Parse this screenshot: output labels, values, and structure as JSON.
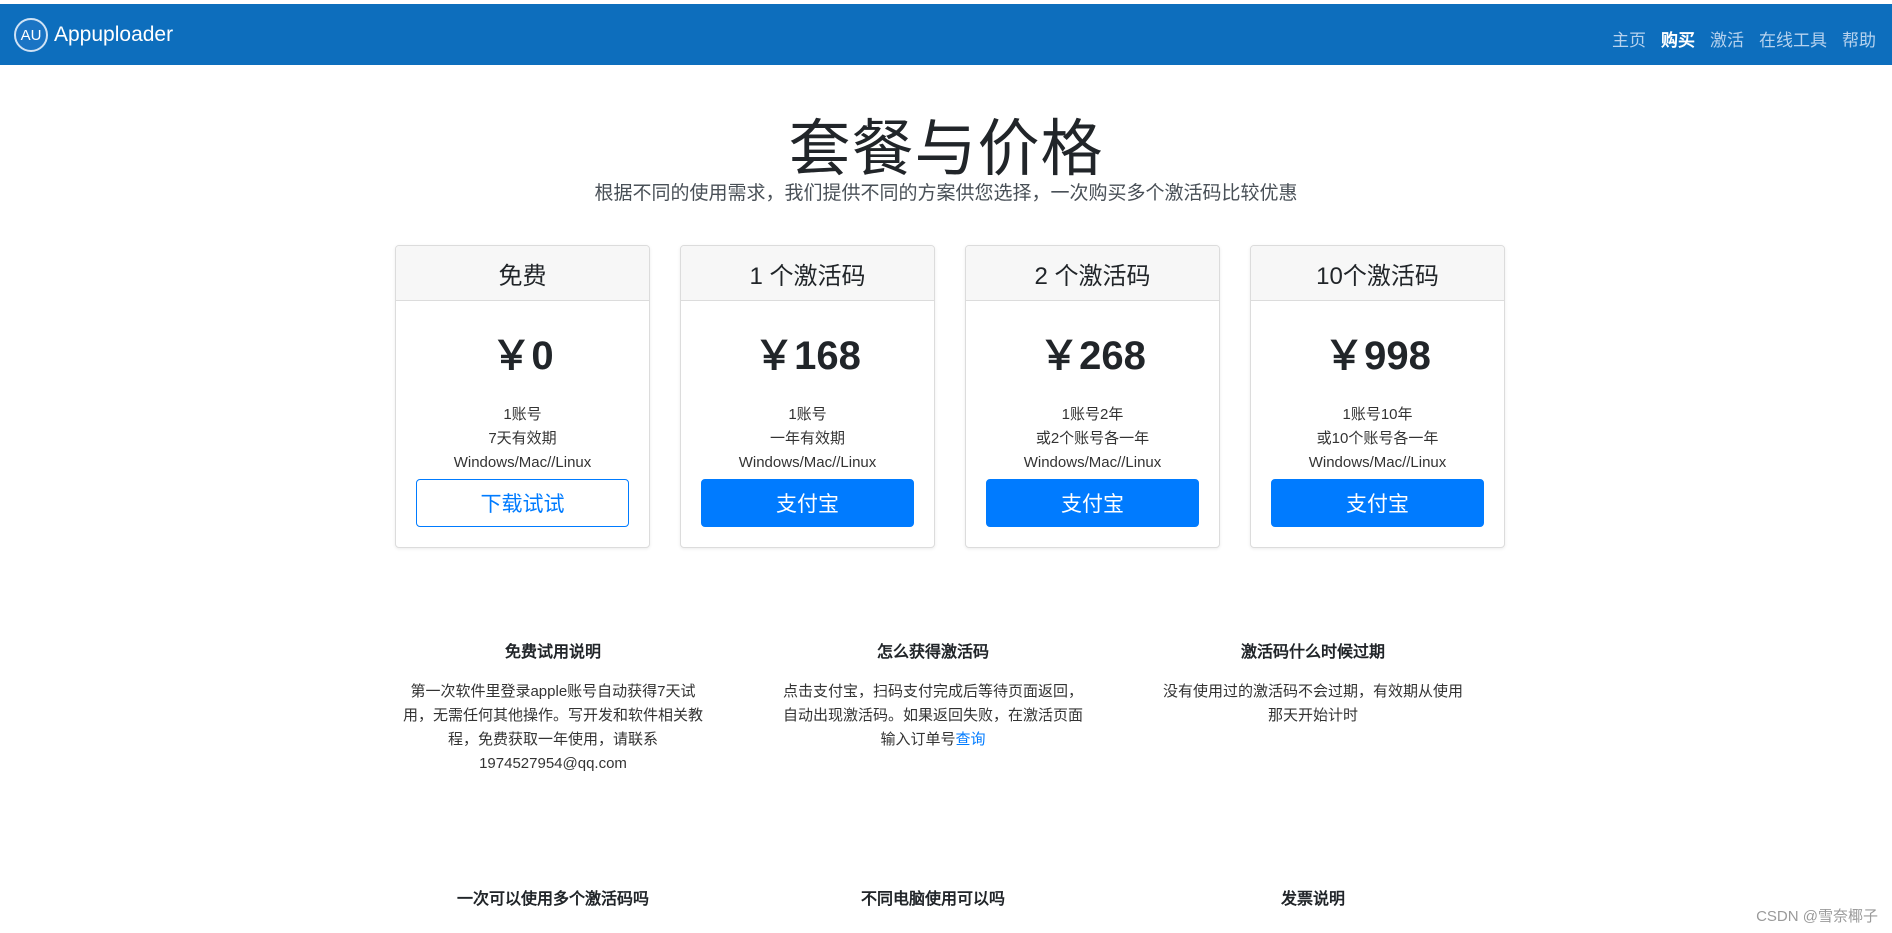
{
  "colors": {
    "navbar": "#0d6ebd",
    "primary": "#007bff"
  },
  "navbar": {
    "logo_text": "AU",
    "brand": "Appuploader",
    "links": [
      "主页",
      "购买",
      "激活",
      "在线工具",
      "帮助"
    ],
    "active": "购买"
  },
  "hero": {
    "title": "套餐与价格",
    "subtitle": "根据不同的使用需求，我们提供不同的方案供您选择，一次购买多个激活码比较优惠"
  },
  "plans": [
    {
      "name": "免费",
      "price": "￥0",
      "features": [
        "1账号",
        "7天有效期",
        "Windows/Mac//Linux"
      ],
      "button": "下载试试"
    },
    {
      "name": "1 个激活码",
      "price": "￥168",
      "features": [
        "1账号",
        "一年有效期",
        "Windows/Mac//Linux"
      ],
      "button": "支付宝"
    },
    {
      "name": "2 个激活码",
      "price": "￥268",
      "features": [
        "1账号2年",
        "或2个账号各一年",
        "Windows/Mac//Linux"
      ],
      "button": "支付宝"
    },
    {
      "name": "10个激活码",
      "price": "￥998",
      "features": [
        "1账号10年",
        "或10个账号各一年",
        "Windows/Mac//Linux"
      ],
      "button": "支付宝"
    }
  ],
  "faq": [
    {
      "title": "免费试用说明",
      "text": "第一次软件里登录apple账号自动获得7天试用，无需任何其他操作。写开发和软件相关教程，免费获取一年使用，请联系1974527954@qq.com"
    },
    {
      "title": "怎么获得激活码",
      "text": "点击支付宝，扫码支付完成后等待页面返回，自动出现激活码。如果返回失败，在激活页面输入订单号",
      "link": "查询"
    },
    {
      "title": "激活码什么时候过期",
      "text": "没有使用过的激活码不会过期，有效期从使用那天开始计时"
    },
    {
      "title": "一次可以使用多个激活码吗"
    },
    {
      "title": "不同电脑使用可以吗"
    },
    {
      "title": "发票说明"
    }
  ],
  "watermark": "CSDN @雪奈椰子"
}
